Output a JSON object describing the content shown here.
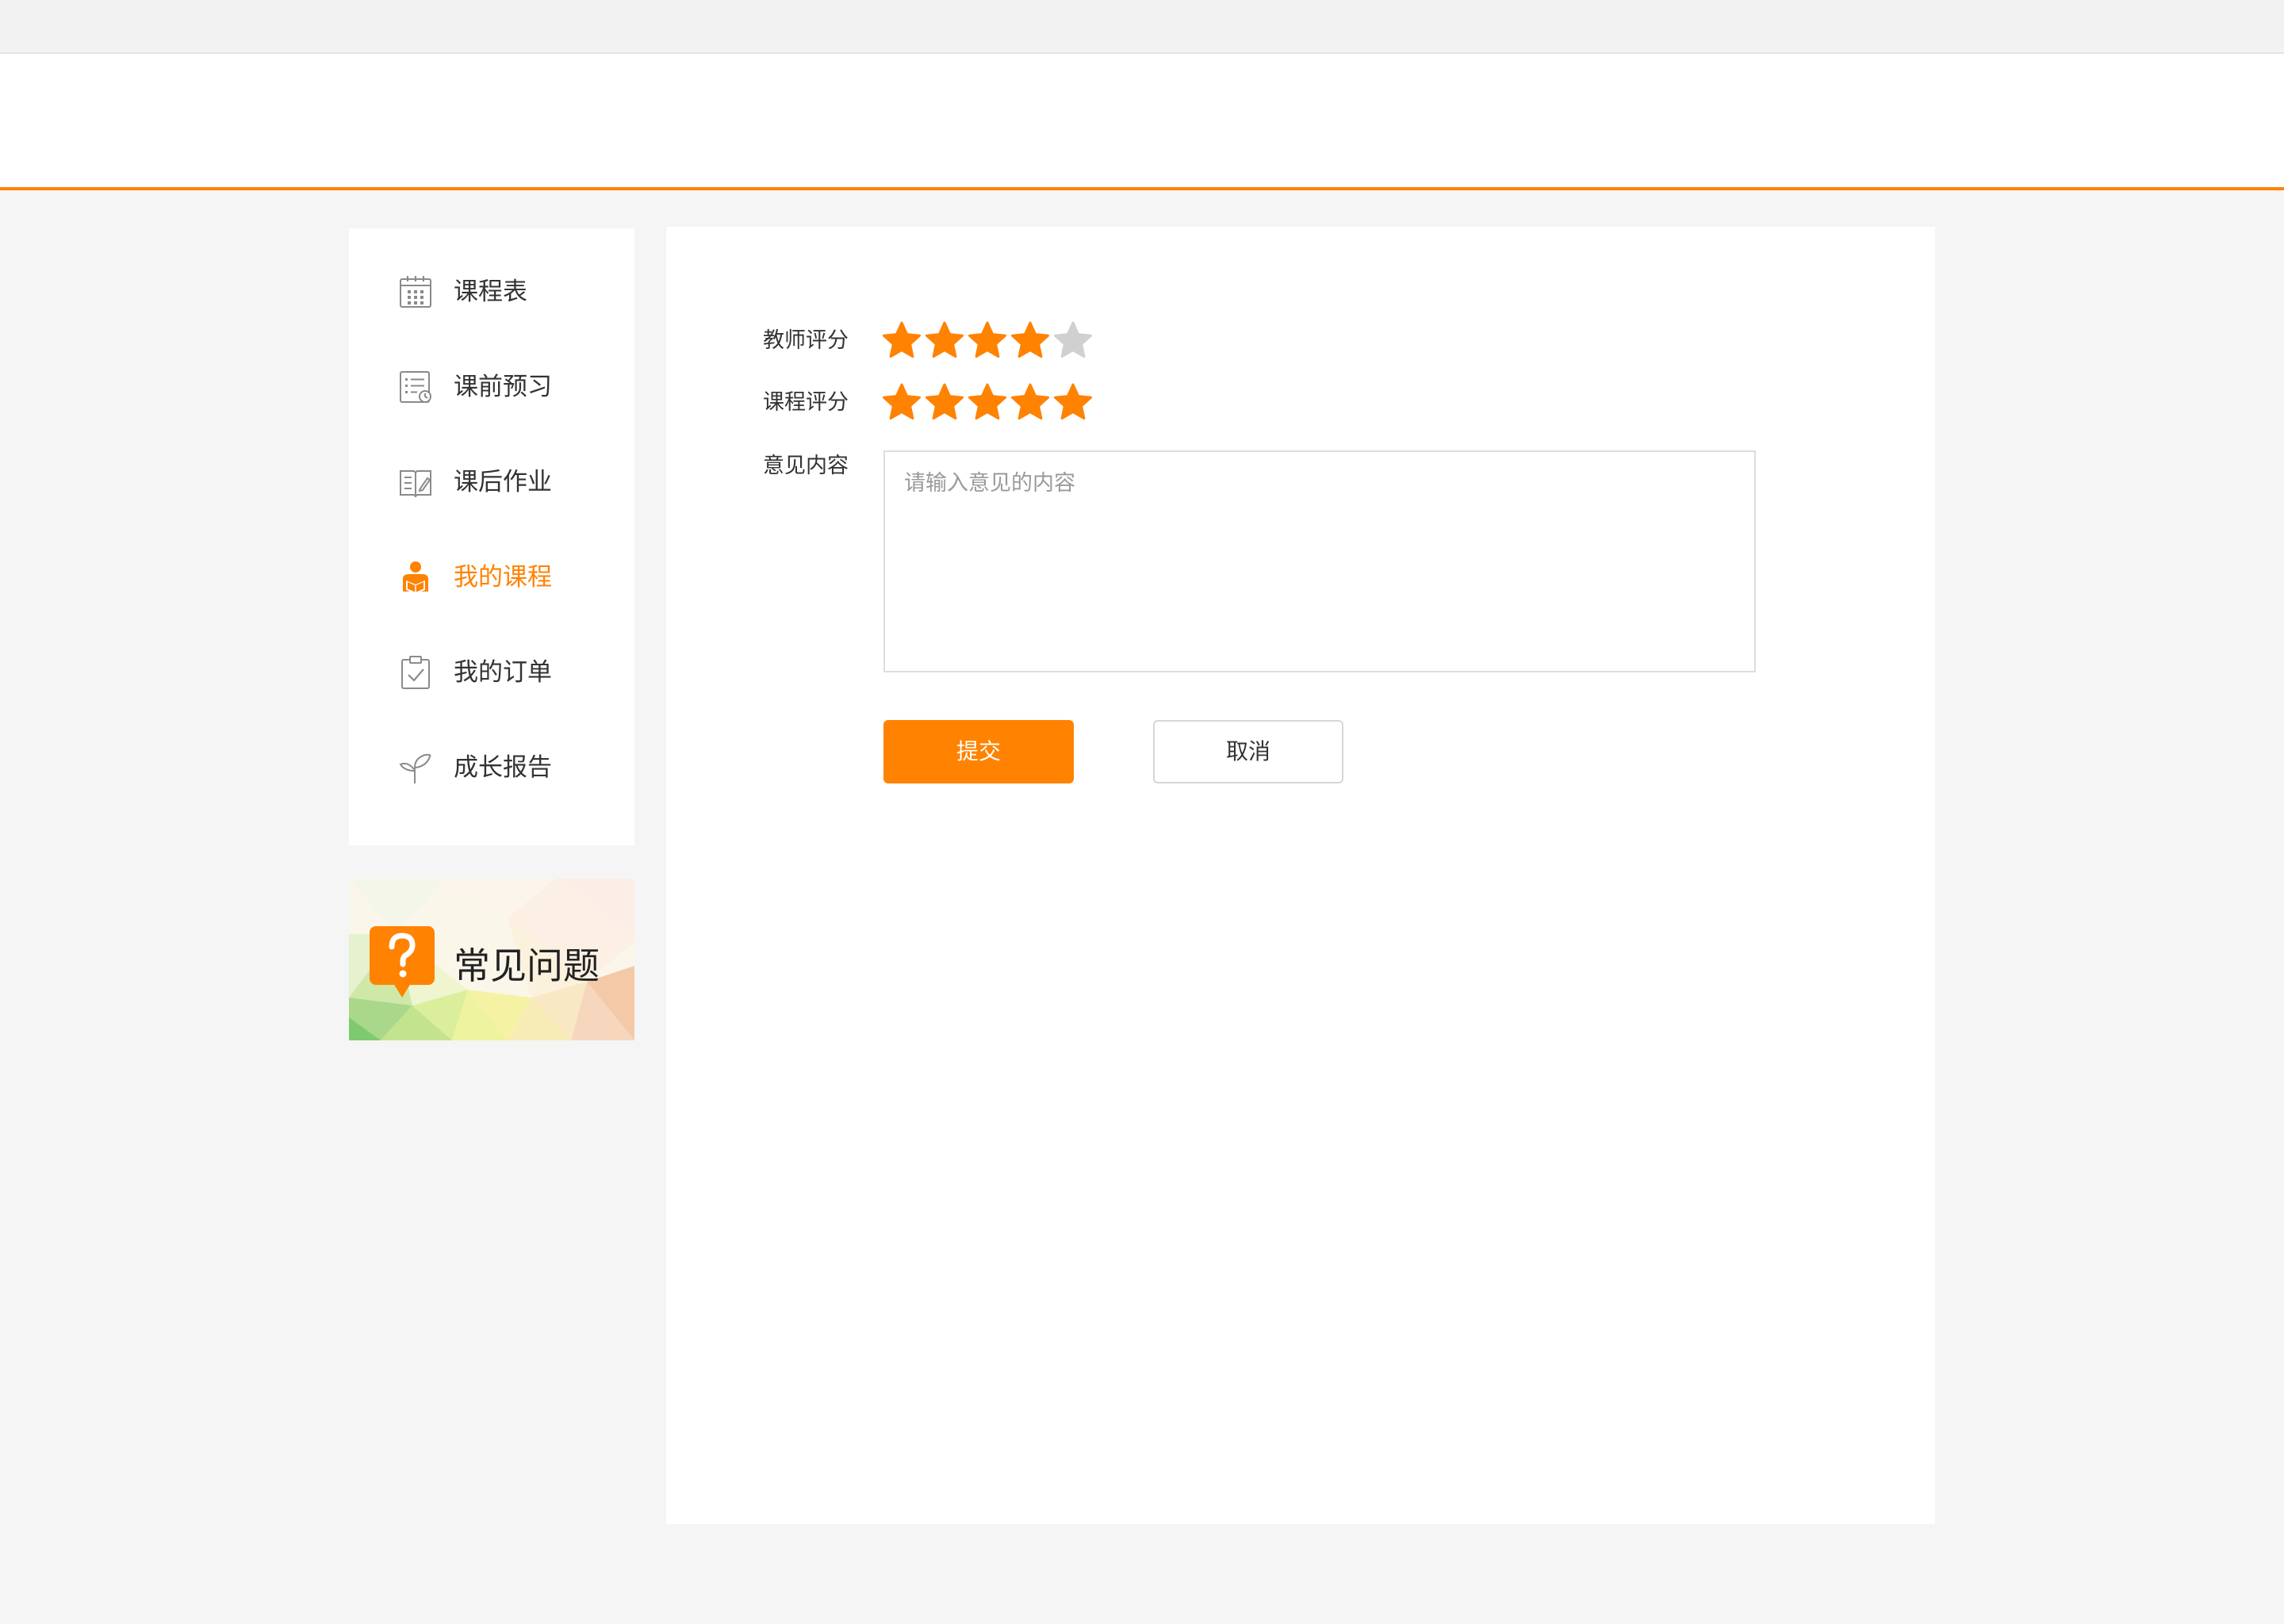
{
  "sidebar": {
    "items": [
      {
        "label": "课程表",
        "icon": "calendar-icon",
        "active": false
      },
      {
        "label": "课前预习",
        "icon": "list-clock-icon",
        "active": false
      },
      {
        "label": "课后作业",
        "icon": "book-edit-icon",
        "active": false
      },
      {
        "label": "我的课程",
        "icon": "student-icon",
        "active": true
      },
      {
        "label": "我的订单",
        "icon": "clipboard-check-icon",
        "active": false
      },
      {
        "label": "成长报告",
        "icon": "sprout-icon",
        "active": false
      }
    ],
    "faq": {
      "label": "常见问题",
      "icon": "question-bubble-icon"
    }
  },
  "form": {
    "teacher_rating": {
      "label": "教师评分",
      "value": 4,
      "max": 5
    },
    "course_rating": {
      "label": "课程评分",
      "value": 5,
      "max": 5
    },
    "feedback": {
      "label": "意见内容",
      "placeholder": "请输入意见的内容",
      "value": ""
    },
    "submit_label": "提交",
    "cancel_label": "取消"
  },
  "colors": {
    "accent": "#ff8200",
    "star_empty": "#d0d0d0",
    "page_background": "#f5f5f5"
  }
}
